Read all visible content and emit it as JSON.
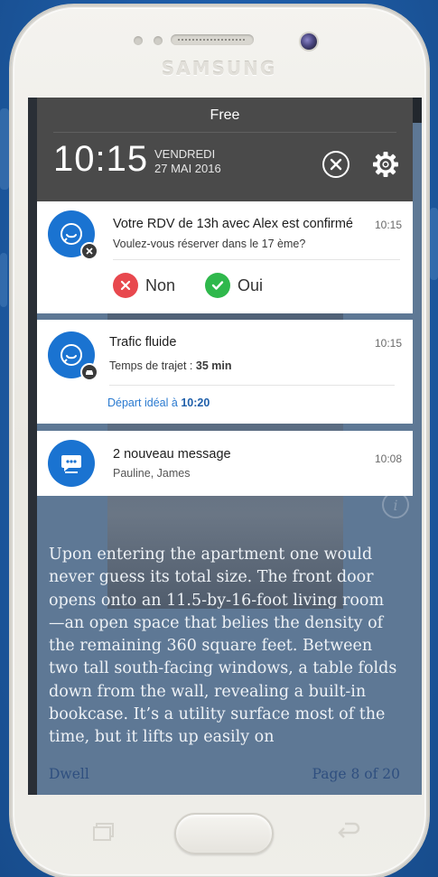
{
  "device": {
    "brand": "SAMSUNG"
  },
  "status": {
    "carrier": "Free",
    "time": "10:15",
    "day": "VENDREDI",
    "date": "27 MAI 2016"
  },
  "notifications": [
    {
      "title": "Votre RDV de 13h avec Alex est confirmé",
      "subtitle": "Voulez-vous réserver dans le 17 ème?",
      "time": "10:15",
      "actions": {
        "no": "Non",
        "yes": "Oui"
      }
    },
    {
      "title": "Trafic fluide",
      "subtitle_label": "Temps de trajet : ",
      "subtitle_value": "35 min",
      "time": "10:15",
      "footer_label": "Départ idéal à ",
      "footer_value": "10:20"
    },
    {
      "title": "2 nouveau message",
      "subtitle": "Pauline, James",
      "time": "10:08"
    }
  ],
  "article": {
    "text": "Upon entering the apartment one would never guess its total size. The front door opens onto an 11.5-by-16-foot living room —an open space that belies the density of the remaining 360 square feet. Between two tall south-facing windows, a table folds down from the wall, revealing a built-in bookcase. It’s a utility surface most of the time, but it lifts up easily on",
    "source": "Dwell",
    "page": "Page 8 of 20"
  },
  "colors": {
    "accent": "#1a73d1",
    "no": "#e8484e",
    "yes": "#2fb84c",
    "shade": "#4a4a4a"
  }
}
